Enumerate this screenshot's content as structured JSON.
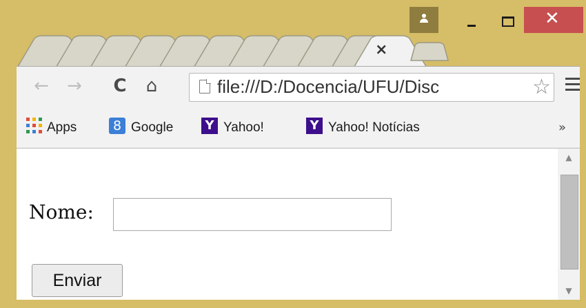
{
  "window": {
    "frame_color": "#d6bd67",
    "controls": {
      "user": "user-icon",
      "minimize": "minimize-icon",
      "maximize": "maximize-icon",
      "close": "✕"
    }
  },
  "tabs": {
    "active_close": "×"
  },
  "toolbar": {
    "back": "←",
    "forward": "→",
    "reload": "C",
    "home": "⌂",
    "url": "file:///D:/Docencia/UFU/Disc",
    "star": "☆"
  },
  "bookmarks": {
    "items": [
      {
        "label": "Apps",
        "icon": "apps-grid-icon"
      },
      {
        "label": "Google",
        "icon": "google-icon",
        "icon_glyph": "8"
      },
      {
        "label": "Yahoo!",
        "icon": "yahoo-icon",
        "icon_glyph": "Y"
      },
      {
        "label": "Yahoo! Notícias",
        "icon": "yahoo-icon",
        "icon_glyph": "Y"
      }
    ],
    "more": "»"
  },
  "form": {
    "nome_label": "Nome:",
    "nome_value": "",
    "submit_label": "Enviar"
  },
  "scrollbar": {
    "up": "▲",
    "down": "▼"
  }
}
